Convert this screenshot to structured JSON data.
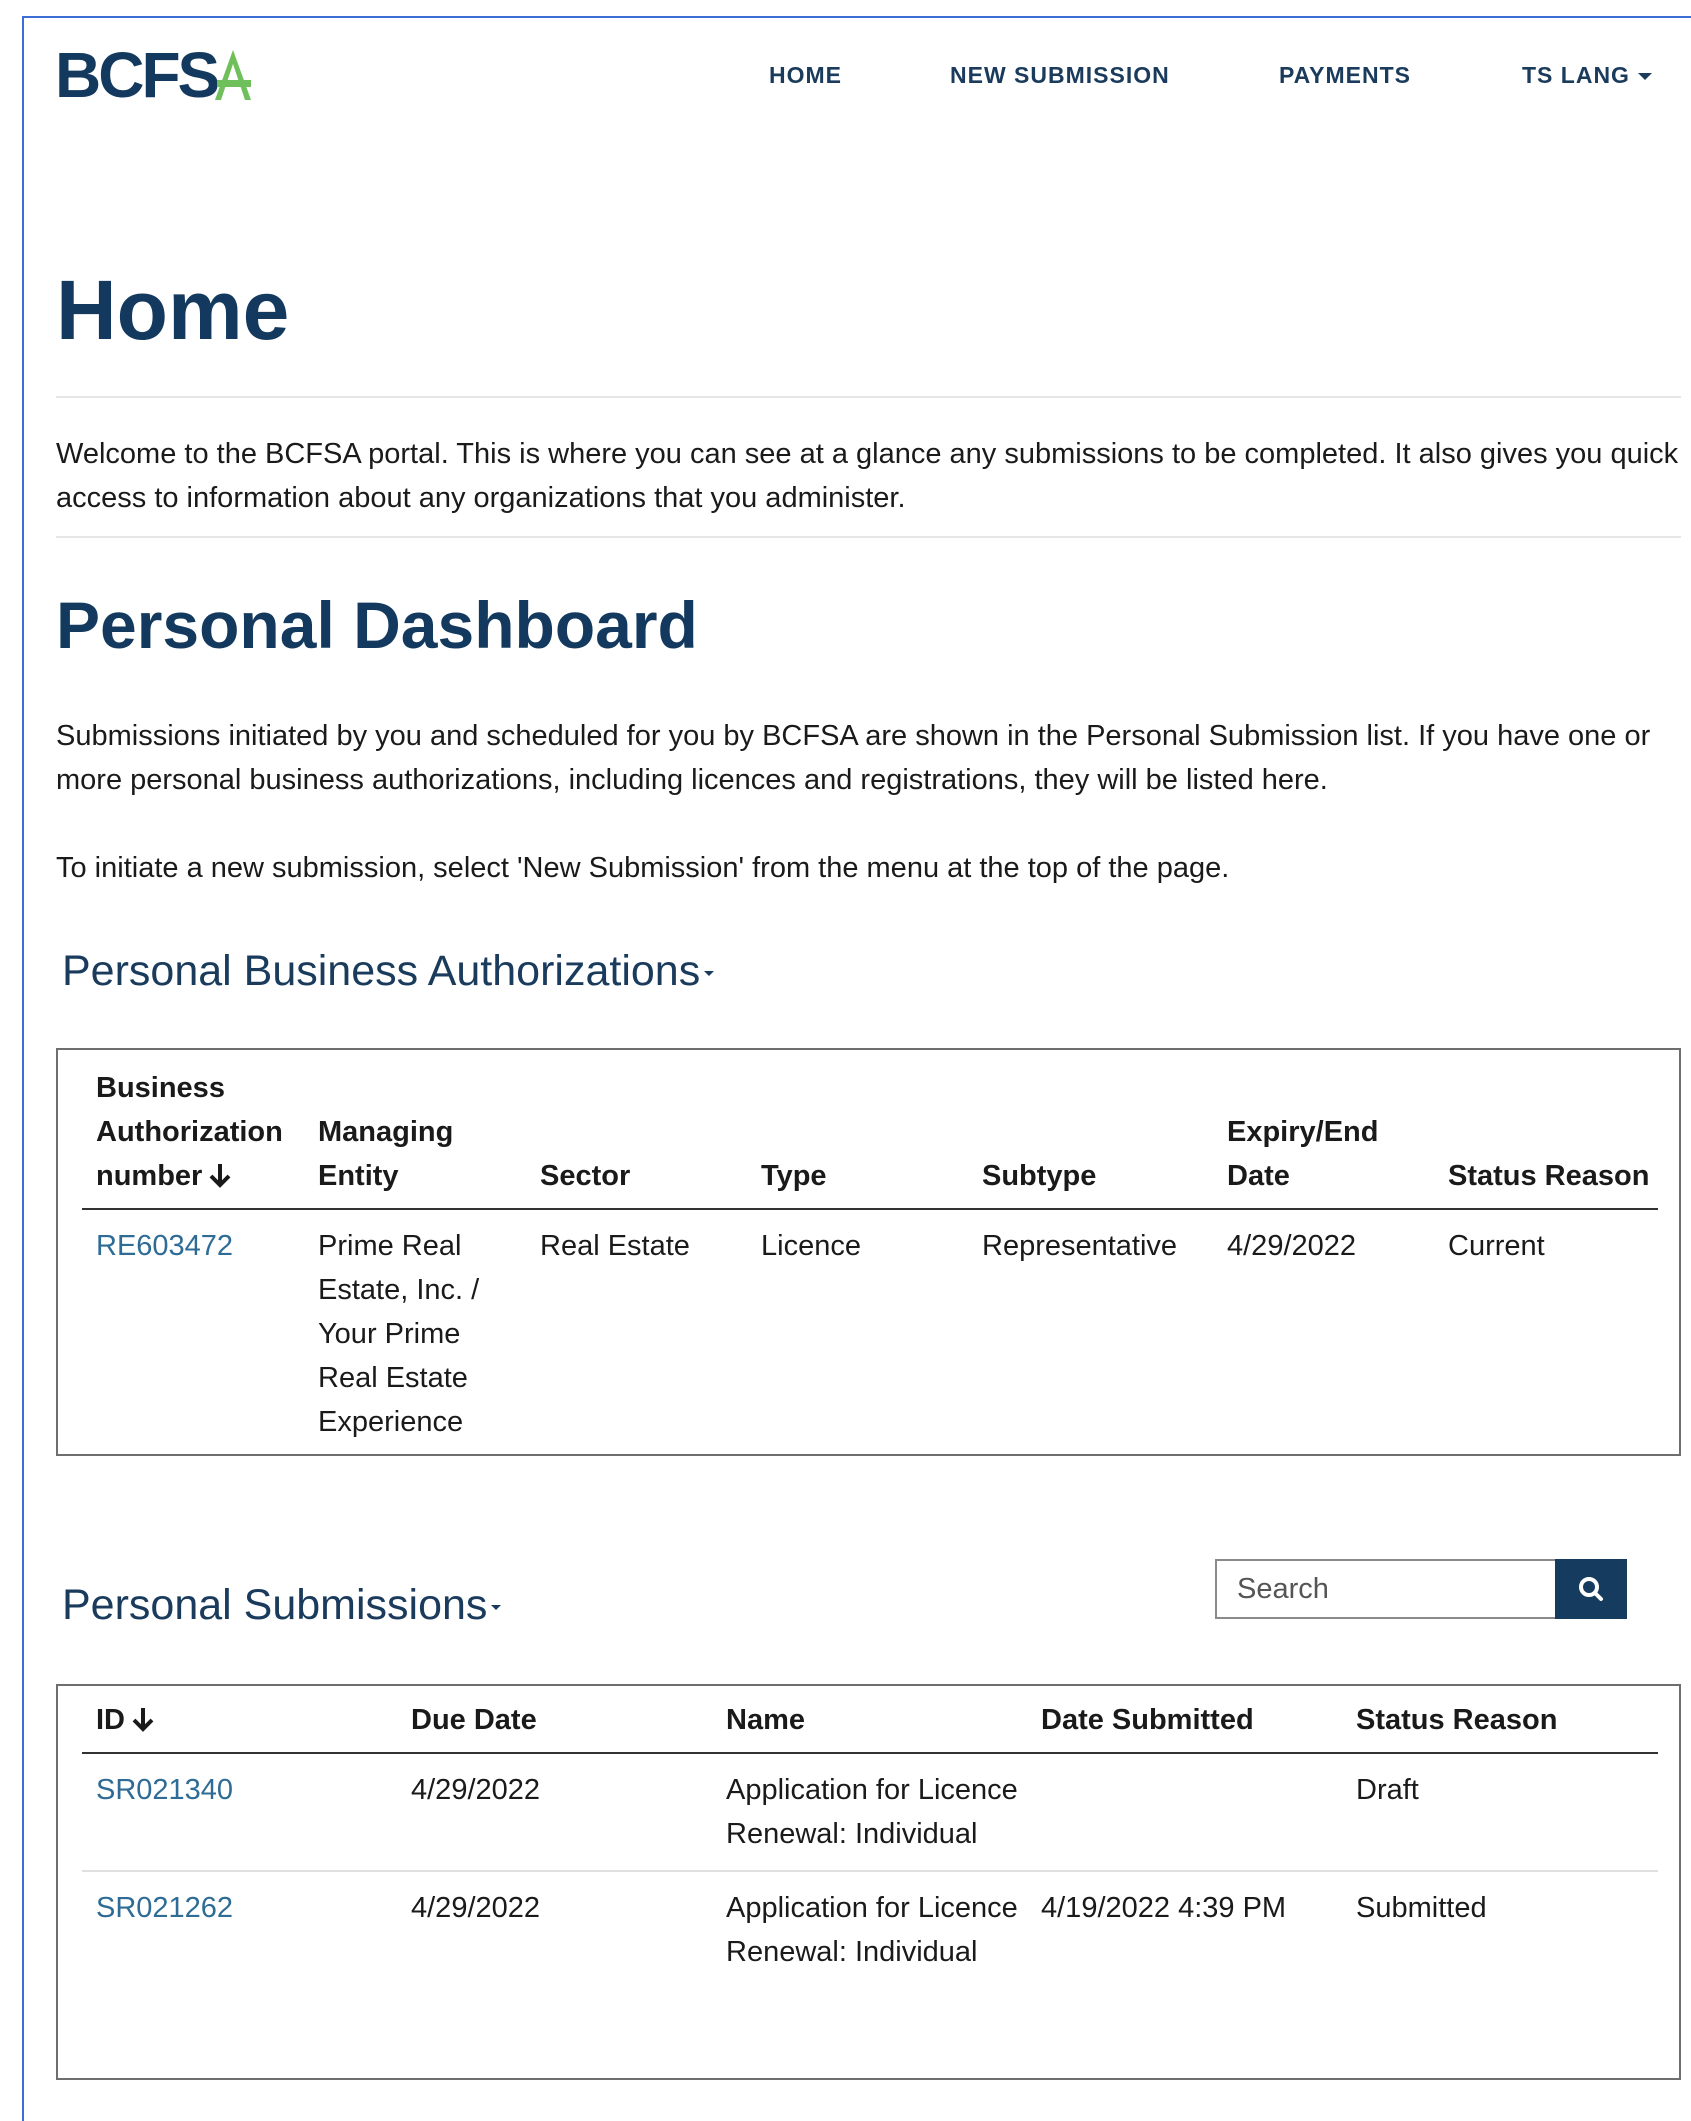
{
  "brand": {
    "logo_text": "BCFSA"
  },
  "nav": {
    "home": "HOME",
    "new_submission": "NEW SUBMISSION",
    "payments": "PAYMENTS",
    "user": "TS LANG"
  },
  "page": {
    "title": "Home",
    "welcome": "Welcome to the BCFSA portal. This is where you can see at a glance any submissions to be completed. It also gives you quick access to information about any organizations that you administer."
  },
  "dashboard": {
    "title": "Personal Dashboard",
    "intro": "Submissions initiated by you and scheduled for you by BCFSA are shown in the Personal Submission list. If you have one or more personal business authorizations, including licences and registrations, they will be listed here.",
    "instruction": "To initiate a new submission, select 'New Submission' from the menu at the top of the page."
  },
  "authorizations": {
    "title": "Personal Business Authorizations",
    "columns": {
      "number": "Business Authorization number",
      "entity": "Managing Entity",
      "sector": "Sector",
      "type": "Type",
      "subtype": "Subtype",
      "expiry": "Expiry/End Date",
      "status": "Status Reason"
    },
    "rows": [
      {
        "number": "RE603472",
        "entity": "Prime Real Estate, Inc. / Your Prime Real Estate Experience",
        "sector": "Real Estate",
        "type": "Licence",
        "subtype": "Representative",
        "expiry": "4/29/2022",
        "status": "Current"
      }
    ]
  },
  "submissions": {
    "title": "Personal Submissions",
    "search_placeholder": "Search",
    "columns": {
      "id": "ID",
      "due": "Due Date",
      "name": "Name",
      "submitted": "Date Submitted",
      "status": "Status Reason"
    },
    "rows": [
      {
        "id": "SR021340",
        "due": "4/29/2022",
        "name": "Application for Licence Renewal: Individual",
        "submitted": "",
        "status": "Draft"
      },
      {
        "id": "SR021262",
        "due": "4/29/2022",
        "name": "Application for Licence Renewal: Individual",
        "submitted": "4/19/2022 4:39 PM",
        "status": "Submitted"
      }
    ]
  },
  "colors": {
    "brand_navy": "#133a5e",
    "brand_green": "#6fbf5a",
    "link": "#2e6b95",
    "search_button": "#153b5f"
  }
}
